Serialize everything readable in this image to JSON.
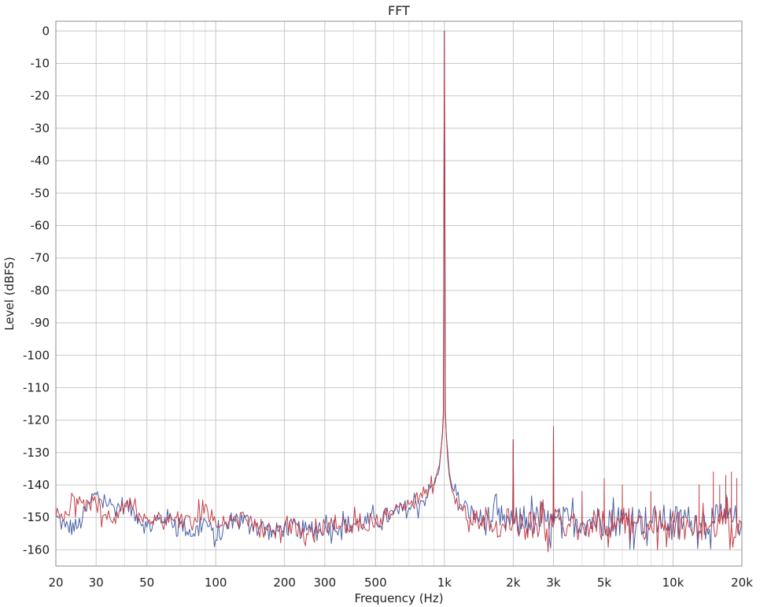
{
  "chart_data": {
    "type": "line",
    "title": "FFT",
    "xlabel": "Frequency (Hz)",
    "ylabel": "Level (dBFS)",
    "x_scale": "log",
    "xlim": [
      20,
      20000
    ],
    "ylim": [
      -165,
      3
    ],
    "grid": true,
    "x_ticks": [
      {
        "value": 20,
        "label": "20"
      },
      {
        "value": 30,
        "label": "30"
      },
      {
        "value": 50,
        "label": "50"
      },
      {
        "value": 100,
        "label": "100"
      },
      {
        "value": 200,
        "label": "200"
      },
      {
        "value": 300,
        "label": "300"
      },
      {
        "value": 500,
        "label": "500"
      },
      {
        "value": 1000,
        "label": "1k"
      },
      {
        "value": 2000,
        "label": "2k"
      },
      {
        "value": 3000,
        "label": "3k"
      },
      {
        "value": 5000,
        "label": "5k"
      },
      {
        "value": 10000,
        "label": "10k"
      },
      {
        "value": 20000,
        "label": "20k"
      }
    ],
    "y_ticks": [
      0,
      -10,
      -20,
      -30,
      -40,
      -50,
      -60,
      -70,
      -80,
      -90,
      -100,
      -110,
      -120,
      -130,
      -140,
      -150,
      -160
    ],
    "series": [
      {
        "color": "#3f57a1",
        "x": [
          20,
          22,
          25,
          28,
          30,
          33,
          36,
          40,
          45,
          50,
          60,
          70,
          80,
          90,
          100,
          120,
          150,
          180,
          200,
          250,
          300,
          400,
          500,
          600,
          700,
          800,
          900,
          950,
          980,
          990,
          995,
          1000,
          1005,
          1010,
          1020,
          1050,
          1100,
          1200,
          1400,
          1600,
          1800,
          1990,
          2000,
          2010,
          2200,
          2500,
          2990,
          3000,
          3010,
          3500,
          4000,
          4500,
          5000,
          6000,
          7000,
          8000,
          9000,
          10000,
          12000,
          15000,
          18000,
          20000
        ],
        "y": [
          -150,
          -153,
          -153,
          -146,
          -143,
          -145,
          -147,
          -146,
          -149,
          -153,
          -150,
          -152,
          -155,
          -151,
          -157,
          -150,
          -152,
          -155,
          -153,
          -154,
          -153,
          -152,
          -151,
          -149,
          -147,
          -145,
          -140,
          -135,
          -125,
          -118,
          -60,
          0,
          -60,
          -118,
          -125,
          -136,
          -142,
          -147,
          -150,
          -151,
          -151,
          -152,
          -126,
          -152,
          -151,
          -151,
          -152,
          -122,
          -152,
          -151,
          -151,
          -151,
          -151,
          -151,
          -151,
          -151,
          -151,
          -151,
          -151,
          -151,
          -151,
          -151
        ]
      },
      {
        "color": "#c0353d",
        "x": [
          20,
          22,
          25,
          28,
          30,
          33,
          36,
          40,
          45,
          50,
          60,
          70,
          80,
          90,
          100,
          120,
          150,
          180,
          200,
          250,
          300,
          400,
          500,
          600,
          700,
          800,
          900,
          950,
          980,
          990,
          995,
          1000,
          1005,
          1010,
          1020,
          1050,
          1100,
          1200,
          1400,
          1600,
          1800,
          1990,
          2000,
          2010,
          2200,
          2500,
          2990,
          3000,
          3010,
          3500,
          3990,
          4000,
          4010,
          4990,
          5000,
          5010,
          5990,
          6000,
          6010,
          7990,
          8000,
          8010,
          9000,
          12990,
          13000,
          13010,
          14990,
          15000,
          15010,
          15990,
          16000,
          16010,
          16990,
          17000,
          17010,
          17990,
          18000,
          18010,
          18990,
          19000,
          19010,
          20000
        ],
        "y": [
          -150,
          -148,
          -146,
          -145.5,
          -146,
          -149,
          -150,
          -146,
          -148,
          -150,
          -151,
          -150,
          -152,
          -146,
          -152,
          -150,
          -153,
          -154,
          -152,
          -155,
          -152,
          -152,
          -151,
          -148,
          -146,
          -144,
          -140,
          -134,
          -124,
          -117,
          -55,
          0,
          -55,
          -117,
          -125,
          -137,
          -143,
          -148,
          -151,
          -152,
          -152,
          -152,
          -126,
          -152,
          -152,
          -152,
          -153,
          -122,
          -152,
          -152,
          -152,
          -142,
          -152,
          -152,
          -138,
          -152,
          -152,
          -140,
          -152,
          -152,
          -142,
          -152,
          -152,
          -152,
          -140,
          -152,
          -152,
          -136,
          -152,
          -152,
          -140,
          -152,
          -152,
          -137,
          -152,
          -152,
          -136,
          -152,
          -152,
          -138,
          -152,
          -153
        ]
      }
    ]
  }
}
